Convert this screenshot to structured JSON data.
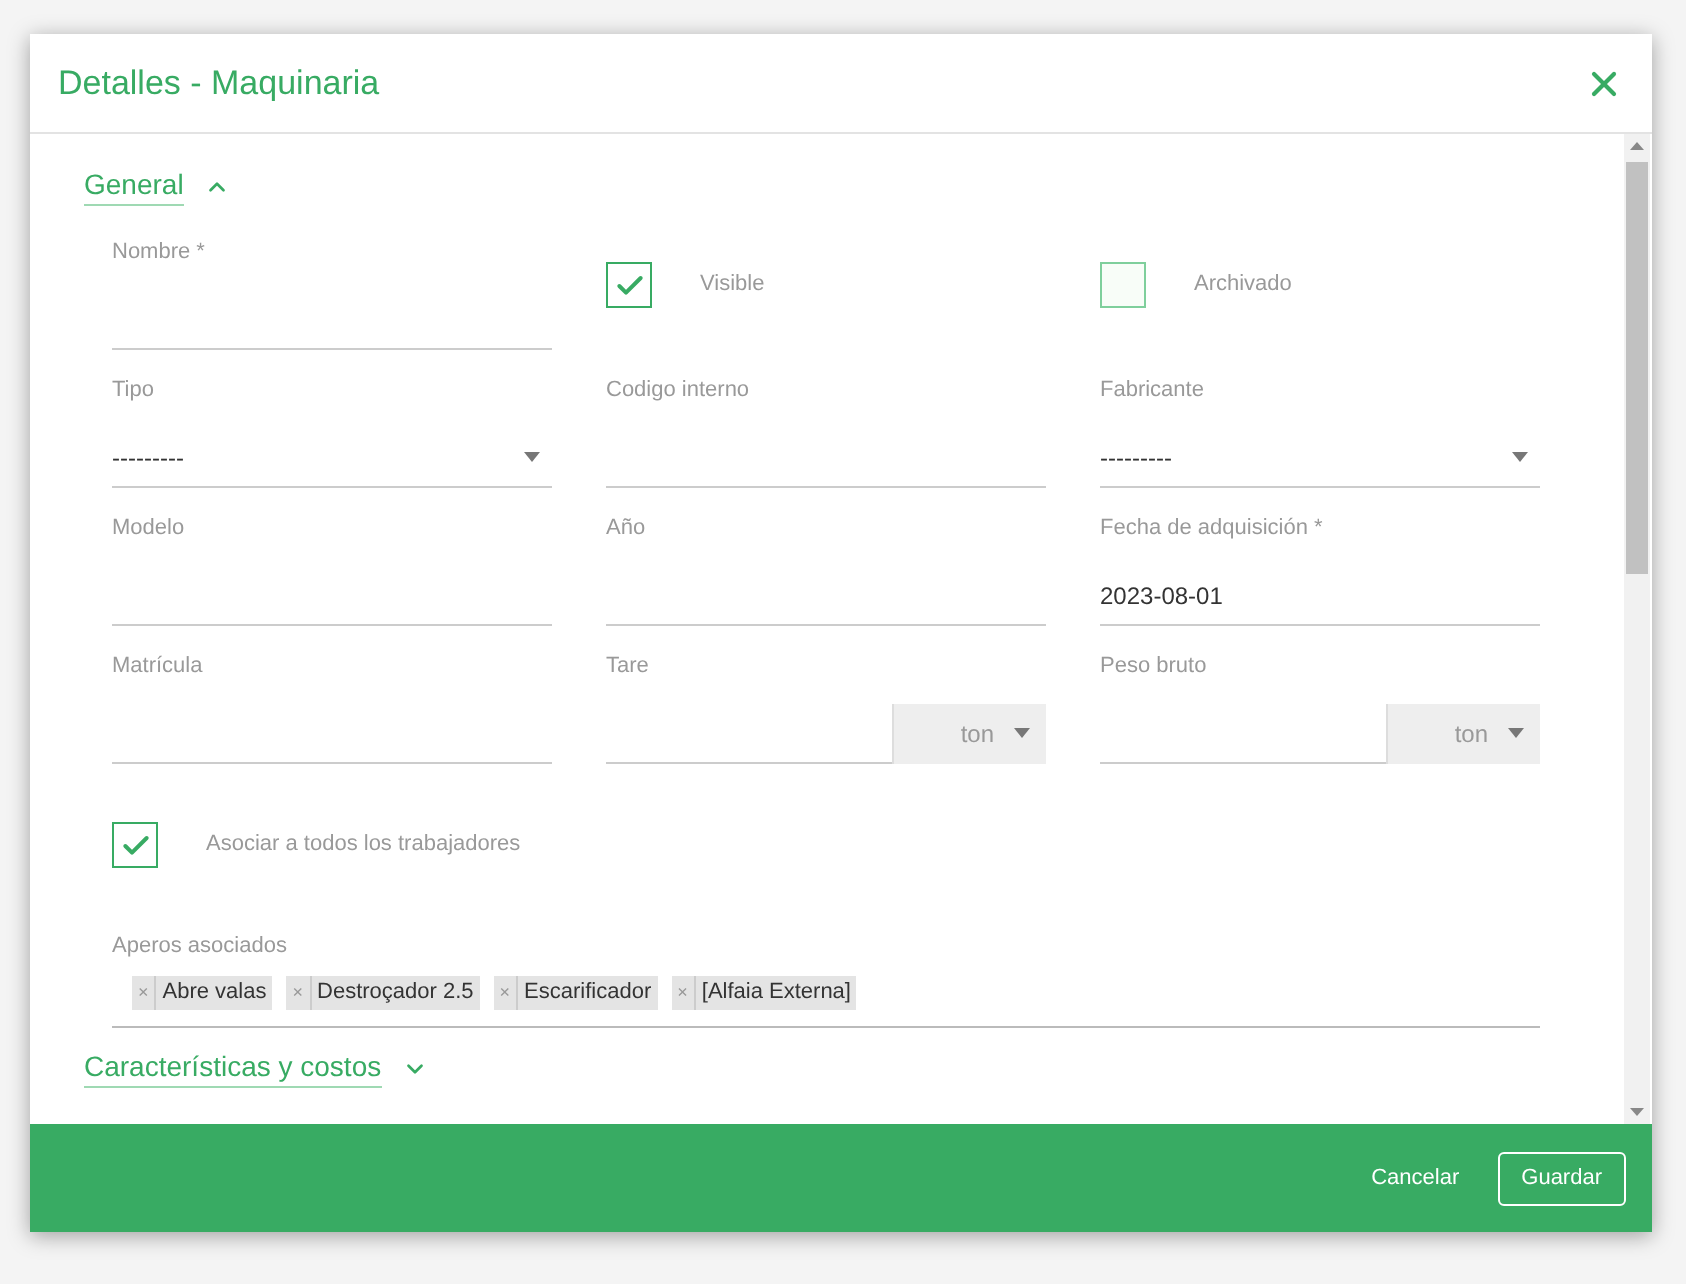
{
  "dialog": {
    "title": "Detalles - Maquinaria"
  },
  "sections": [
    {
      "title": "General",
      "expanded": true,
      "rows": [
        [
          {
            "kind": "text",
            "label": "Nombre *"
          },
          {
            "kind": "checkbox",
            "label": "Visible",
            "checked": true
          },
          {
            "kind": "checkbox",
            "label": "Archivado",
            "checked": false
          }
        ],
        [
          {
            "kind": "select",
            "label": "Tipo",
            "value": "---------"
          },
          {
            "kind": "text",
            "label": "Codigo interno"
          },
          {
            "kind": "select",
            "label": "Fabricante",
            "value": "---------"
          }
        ],
        [
          {
            "kind": "text",
            "label": "Modelo"
          },
          {
            "kind": "text",
            "label": "Año"
          },
          {
            "kind": "text",
            "label": "Fecha de adquisición *",
            "value": "2023-08-01"
          }
        ],
        [
          {
            "kind": "unit",
            "label": "Matrícula"
          },
          {
            "kind": "unit",
            "label": "Tare",
            "unit": "ton"
          },
          {
            "kind": "unit",
            "label": "Peso bruto",
            "unit": "ton"
          }
        ]
      ],
      "associate_all": {
        "label": "Asociar a todos los trabajadores",
        "checked": true
      },
      "implements": {
        "label": "Aperos asociados",
        "remove_glyph": "×",
        "tags": [
          "Abre valas",
          "Destroçador 2.5",
          "Escarificador",
          "[Alfaia Externa]"
        ]
      }
    },
    {
      "title": "Características y costos",
      "expanded": false
    }
  ],
  "footer": {
    "buttons": [
      "Cancelar",
      "Guardar"
    ]
  }
}
